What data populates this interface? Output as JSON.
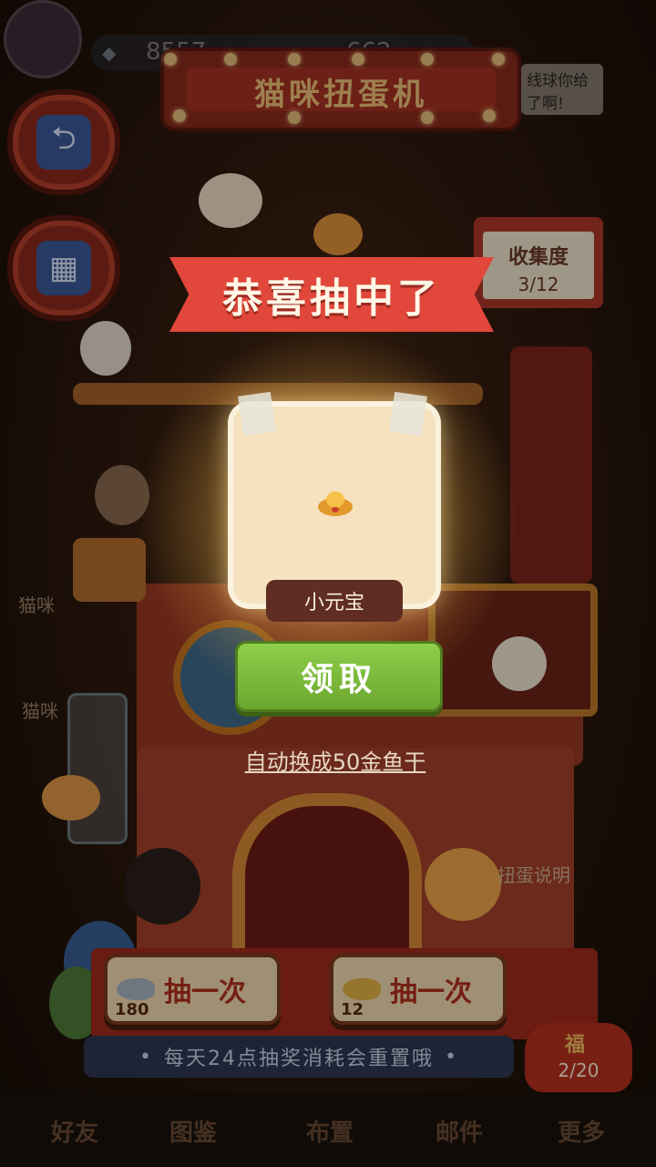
{
  "header": {
    "title": "猫咪扭蛋机",
    "currency_1": "8557",
    "currency_2": "662",
    "speech_bubble": "线球你给了啊!"
  },
  "collection": {
    "label": "收集度",
    "progress": "3/12"
  },
  "popup": {
    "banner": "恭喜抽中了",
    "item_name": "小元宝",
    "claim_button": "领取",
    "auto_convert_note": "自动换成50金鱼干"
  },
  "machine": {
    "help_label": "扭蛋说明",
    "draw_buttons": [
      {
        "label": "抽一次",
        "cost": "180",
        "icon": "silver-fish-icon"
      },
      {
        "label": "抽一次",
        "cost": "12",
        "icon": "gold-fish-icon"
      }
    ],
    "reset_notice": "每天24点抽奖消耗会重置哦"
  },
  "side": {
    "left_label_1": "猫咪",
    "left_label_2": "猫咪"
  },
  "fortune_bag": {
    "label": "福",
    "count": "2/20"
  },
  "bottom_nav": [
    "好友",
    "图鉴",
    "布置",
    "邮件",
    "更多"
  ],
  "colors": {
    "ribbon": "#e1473a",
    "claim_green": "#7dbb3c",
    "card": "#f6e2bf"
  }
}
